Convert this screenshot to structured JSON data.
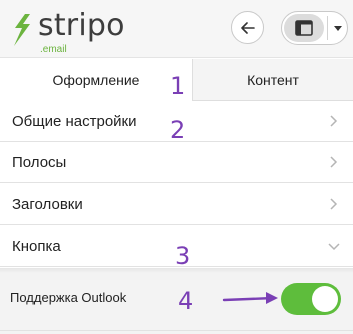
{
  "header": {
    "logo_text": "stripo",
    "logo_subtext": ".email",
    "back_icon": "arrow-left-icon",
    "view_icon": "layout-panel-icon",
    "dropdown_icon": "caret-down-icon"
  },
  "tabs": [
    {
      "label": "Оформление",
      "active": true
    },
    {
      "label": "Контент",
      "active": false
    }
  ],
  "sections": [
    {
      "label": "Общие настройки",
      "state": "collapsed"
    },
    {
      "label": "Полосы",
      "state": "collapsed"
    },
    {
      "label": "Заголовки",
      "state": "collapsed"
    },
    {
      "label": "Кнопка",
      "state": "expanded"
    }
  ],
  "button_settings": {
    "outlook_support_label": "Поддержка Outlook",
    "outlook_support_enabled": true
  },
  "annotations": [
    "1",
    "2",
    "3",
    "4"
  ],
  "colors": {
    "brand_green": "#6cb43f",
    "toggle_on": "#5ebd3c",
    "annotation_purple": "#7a3fb5"
  }
}
